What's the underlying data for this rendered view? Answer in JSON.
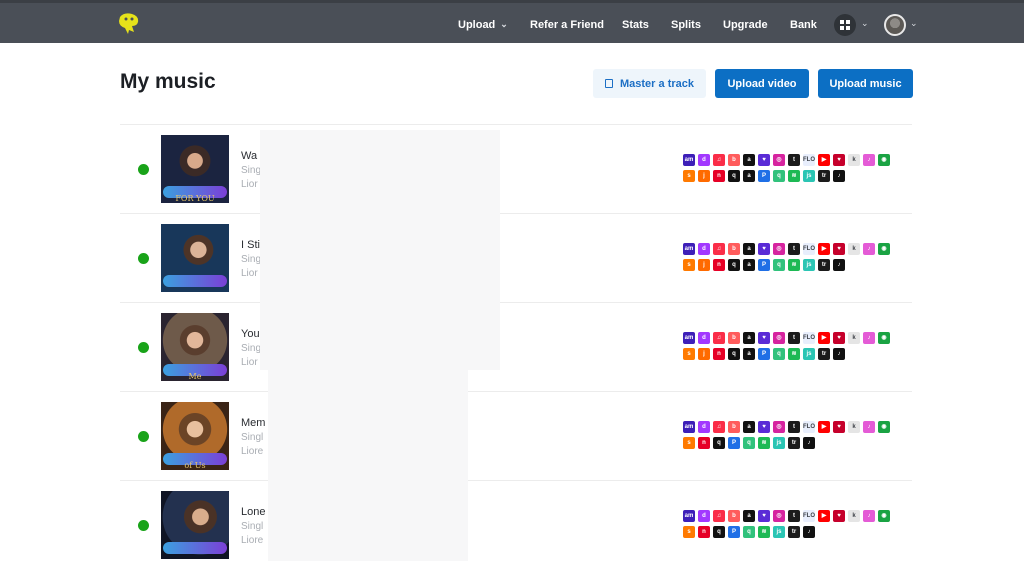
{
  "nav": {
    "items": [
      "Upload",
      "Refer a Friend",
      "Stats",
      "Splits",
      "Upgrade",
      "Bank"
    ],
    "upload_has_menu": true,
    "icons": [
      "logo-icon",
      "apps-grid-icon",
      "avatar"
    ]
  },
  "page": {
    "title": "My music",
    "buttons": {
      "master": "Master a track",
      "upload_video": "Upload video",
      "upload_music": "Upload music"
    }
  },
  "colors": {
    "topbar": "#4a4f57",
    "accent": "#0c6fc4",
    "status_live": "#19a319"
  },
  "tracks": [
    {
      "title": "Wa",
      "line1": "Sing",
      "line2": "Lior",
      "cover_caption": "FOR YOU"
    },
    {
      "title": "I Sti",
      "line1": "Sing",
      "line2": "Lior",
      "cover_caption": ""
    },
    {
      "title": "You",
      "line1": "Sing",
      "line2": "Lior",
      "cover_caption": "Me"
    },
    {
      "title": "Mem",
      "line1": "Singl",
      "line2": "Liore",
      "cover_caption": "of Us"
    },
    {
      "title": "Lone",
      "line1": "Singl",
      "line2": "Liore",
      "cover_caption": ""
    }
  ],
  "store_icons": [
    {
      "name": "amazon-music-icon",
      "color": "#3d1fb8",
      "glyph": "am"
    },
    {
      "name": "deezer-icon",
      "color": "#a238ff",
      "glyph": "d"
    },
    {
      "name": "apple-music-icon",
      "color": "#fa2d48",
      "glyph": "♫"
    },
    {
      "name": "boomplay-icon",
      "color": "#ff5c5c",
      "glyph": "b"
    },
    {
      "name": "anghami-icon",
      "color": "#111111",
      "glyph": "a"
    },
    {
      "name": "audiomack-icon",
      "color": "#5a2bd6",
      "glyph": "♥"
    },
    {
      "name": "instagram-icon",
      "color": "#d6249f",
      "glyph": "◎"
    },
    {
      "name": "tidal-icon",
      "color": "#1b1b1b",
      "glyph": "t"
    },
    {
      "name": "flo-icon",
      "color": "#e8eefc",
      "glyph": "FLO"
    },
    {
      "name": "youtube-music-icon",
      "color": "#ff0000",
      "glyph": "▶"
    },
    {
      "name": "iheart-icon",
      "color": "#c6002b",
      "glyph": "♥"
    },
    {
      "name": "kkbox-icon",
      "color": "#e5e5e5",
      "glyph": "k"
    },
    {
      "name": "itunes-icon",
      "color": "#e45bd6",
      "glyph": "♪"
    },
    {
      "name": "napster-icon",
      "color": "#1aa343",
      "glyph": "◉"
    }
  ],
  "store_icons_row2": [
    {
      "name": "soundcloud-icon",
      "color": "#ff7a00",
      "glyph": "s"
    },
    {
      "name": "joox-icon",
      "color": "#ff6a00",
      "glyph": "j"
    },
    {
      "name": "netease-icon",
      "color": "#e60026",
      "glyph": "n"
    },
    {
      "name": "qobuz-icon",
      "color": "#111111",
      "glyph": "q"
    },
    {
      "name": "anghami-alt-icon",
      "color": "#111111",
      "glyph": "a"
    },
    {
      "name": "pandora-icon",
      "color": "#1f6fe6",
      "glyph": "P"
    },
    {
      "name": "qq-music-icon",
      "color": "#31c27c",
      "glyph": "q"
    },
    {
      "name": "spotify-icon",
      "color": "#1db954",
      "glyph": "≋"
    },
    {
      "name": "jiosaavn-icon",
      "color": "#2bc5b4",
      "glyph": "js"
    },
    {
      "name": "trebel-icon",
      "color": "#1b1b1b",
      "glyph": "tr"
    },
    {
      "name": "tiktok-icon",
      "color": "#111111",
      "glyph": "♪"
    }
  ],
  "store_icons_row2_short": [
    {
      "name": "soundcloud-icon",
      "color": "#ff7a00",
      "glyph": "s"
    },
    {
      "name": "netease-icon",
      "color": "#e60026",
      "glyph": "n"
    },
    {
      "name": "qobuz-icon",
      "color": "#111111",
      "glyph": "q"
    },
    {
      "name": "pandora-icon",
      "color": "#1f6fe6",
      "glyph": "P"
    },
    {
      "name": "qq-music-icon",
      "color": "#31c27c",
      "glyph": "q"
    },
    {
      "name": "spotify-icon",
      "color": "#1db954",
      "glyph": "≋"
    },
    {
      "name": "jiosaavn-icon",
      "color": "#2bc5b4",
      "glyph": "js"
    },
    {
      "name": "trebel-icon",
      "color": "#1b1b1b",
      "glyph": "tr"
    },
    {
      "name": "tiktok-icon",
      "color": "#111111",
      "glyph": "♪"
    }
  ]
}
